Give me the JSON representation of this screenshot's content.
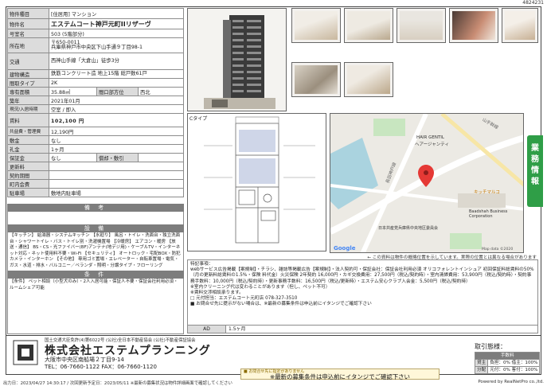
{
  "doc_id": "4824231",
  "property": {
    "rows": [
      {
        "label": "物件種目",
        "value": "[住居用] マンション"
      },
      {
        "label": "物件名",
        "value": "エステムコート神戸元町IIリザーヴ"
      },
      {
        "label": "号室名",
        "value": "503 (5階部分)"
      },
      {
        "label": "所在地",
        "value": "〒650-0011\n兵庫県神戸市中央区下山手通９丁目98-1"
      },
      {
        "label": "交通",
        "value": "西神山手線「大倉山」徒歩3分"
      },
      {
        "label": "建物構造",
        "value": "鉄筋コンクリート造  地上15階  総戸数61戸"
      },
      {
        "label": "間取タイプ",
        "value": "2K"
      },
      {
        "label": "専有面積",
        "value": "35.88㎡",
        "label2": "間口部方位",
        "value2": "西北"
      },
      {
        "label": "築年",
        "value": "2021年01月"
      },
      {
        "label": "現況/入居時期",
        "value": "空室 / 即入"
      },
      {
        "label": "賃料",
        "value": "102,100 円"
      },
      {
        "label": "共益費・管理費",
        "value": "12,190円"
      },
      {
        "label": "敷金",
        "value": "なし"
      },
      {
        "label": "礼金",
        "value": "1ヶ月"
      },
      {
        "label": "保証金",
        "value": "なし",
        "label2": "償却・敷引",
        "value2": ""
      },
      {
        "label": "更新料",
        "value": ""
      },
      {
        "label": "契約期間",
        "value": ""
      },
      {
        "label": "町内会費",
        "value": ""
      },
      {
        "label": "駐車場",
        "value": "敷地内駐車場"
      }
    ],
    "biko_title": "備 考",
    "setsubi_title": "設 備",
    "setsubi_text": "【キッチン】 給湯器・システムキッチン 【水廻り】 風呂・トイレ・洗面台・独立洗面台・シャワートイレ・バス・トイレ別・洗濯機置場 【冷暖房】 エアコン・暖房 【放送・通信】 BS・CS・光ファイバー(BF)アンテナ(地デジ用)・ケーブルTV・インターネット対応・ネット使用料不要・Wi-Fi 【セキュリティ】 オートロック・宅配BOX・防犯カメラ・インターホン 【その他】 専用ゴミ置場・エレベーター・自転車置場・電気・ガス・水道・排水・バルコニー／ベランダ・照明・分譲タイプ・フローリング",
    "joken_title": "条 件",
    "joken_text": "【条件】 ペット相談（小型犬のみ）・2人入居可能・保証人不要・保証会社利用必須・ルームシェア可能"
  },
  "photos": {
    "main_caption": "エステムコート神戸元町IIリザーヴ外観",
    "thumb_count": 7
  },
  "plan": {
    "label": "Cタイプ"
  },
  "map": {
    "labels": [
      "HAIR GENTIL",
      "ヘアージャンティ",
      "キッチマルコ",
      "Baadshah Business Corporation",
      "日本共産党兵庫県中央地区委員会",
      "山手幹線",
      "長田神戸線",
      "Google",
      "Map data ©2020"
    ],
    "caption": "← この資料は物件の概略位置を示しています。実際の位置とは異なる場合があります"
  },
  "remarks": {
    "title": "特記事項：",
    "lines": [
      "webサービス広告掲載【案規制】・チラシ、雑誌等掲載広告【案規制】・法人契約可・保証会社：保証会社利用必須 オリコフォレントインシュア 初回保証料総賃料の50%（月の更新料総賃料の1.5%・保険 料代金）火災保険 2年契約 16,000円・カギ交換費用：27,500円（税込/契約時）・室内清掃費用：53,900円（税込/契約時）・契約事務手数料：10,000円（税込/契約時）・更新事務手数料：16,500円（税込/更新時）・エステム安心クラブ入会金：5,500円（税込/契約時）",
      "※室内クリーニング代は変わることがあります（但し、ペット不可）",
      "※賃料交渉相談承ります。",
      "□ 元付担当：エステムコート元町店  078-327-3510",
      "■ お問合せ先に提示がない場合は、※最新の募集条件は申込前にイタンジでご確認下さい"
    ]
  },
  "ad": {
    "label": "AD",
    "value": "1.5ヶ月"
  },
  "company": {
    "license": "国土交通大臣免許(4)第6022号  (公社)全日本不動産協会  (公社)不動産保証協会",
    "name": "株式会社エステムプランニング",
    "address": "大阪市中央区南船場２丁目9-14",
    "tel": "TEL：06-7660-1122  FAX：06-7660-1120"
  },
  "trade": {
    "title": "取引態様：",
    "header": "手数料",
    "rows": [
      {
        "k": "貸主",
        "v": "負担：0%  借主：100%"
      },
      {
        "k": "分配",
        "v": "元付：0%  客付：100%"
      }
    ]
  },
  "banner": {
    "small": "■ お問合せ先に指定がありません",
    "big": "※最新の募集条件は申込前にイタンジでご確認下さい"
  },
  "footer": {
    "left": "出力日：2023/04/27 14:30:17 / 次回更新予定日：2023/05/11 ※最新の募集状況は物件詳細画面で確認してください",
    "right": "Powered by RealNetPro co.,ltd."
  },
  "vtab": [
    "業",
    "務",
    "情",
    "報"
  ],
  "colors": {
    "green": "#2f9e47",
    "header_gray": "#dcdcdc",
    "bar_gray": "#7d7d7d"
  }
}
